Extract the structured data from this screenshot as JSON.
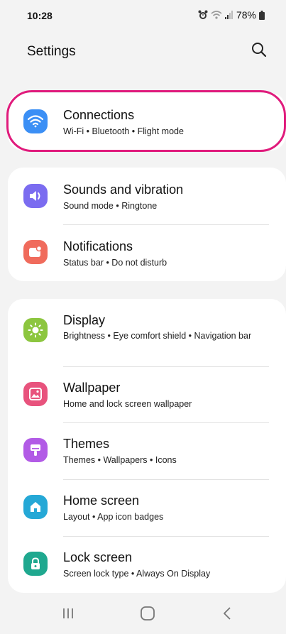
{
  "status": {
    "time": "10:28",
    "battery": "78%"
  },
  "header": {
    "title": "Settings"
  },
  "groups": [
    {
      "items": [
        {
          "label": "Connections",
          "sub": "Wi-Fi  •  Bluetooth  •  Flight mode",
          "icon": "wifi-icon",
          "color": "#3b8ff5"
        }
      ]
    },
    {
      "items": [
        {
          "label": "Sounds and vibration",
          "sub": "Sound mode  •  Ringtone",
          "icon": "speaker-icon",
          "color": "#7b6cf0"
        },
        {
          "label": "Notifications",
          "sub": "Status bar  •  Do not disturb",
          "icon": "notification-icon",
          "color": "#f06b5c"
        }
      ]
    },
    {
      "items": [
        {
          "label": "Display",
          "sub": "Brightness  •  Eye comfort shield  •  Navigation bar",
          "icon": "sun-icon",
          "color": "#8cc63f"
        },
        {
          "label": "Wallpaper",
          "sub": "Home and lock screen wallpaper",
          "icon": "picture-icon",
          "color": "#e8537d"
        },
        {
          "label": "Themes",
          "sub": "Themes  •  Wallpapers  •  Icons",
          "icon": "brush-icon",
          "color": "#b25be6"
        },
        {
          "label": "Home screen",
          "sub": "Layout  •  App icon badges",
          "icon": "home-icon",
          "color": "#25a8d6"
        },
        {
          "label": "Lock screen",
          "sub": "Screen lock type  •  Always On Display",
          "icon": "lock-icon",
          "color": "#1fa88f"
        }
      ]
    }
  ],
  "highlight_color": "#e01b7c",
  "navbar": {
    "icons": [
      "recent-apps-icon",
      "home-button-icon",
      "back-icon"
    ]
  }
}
